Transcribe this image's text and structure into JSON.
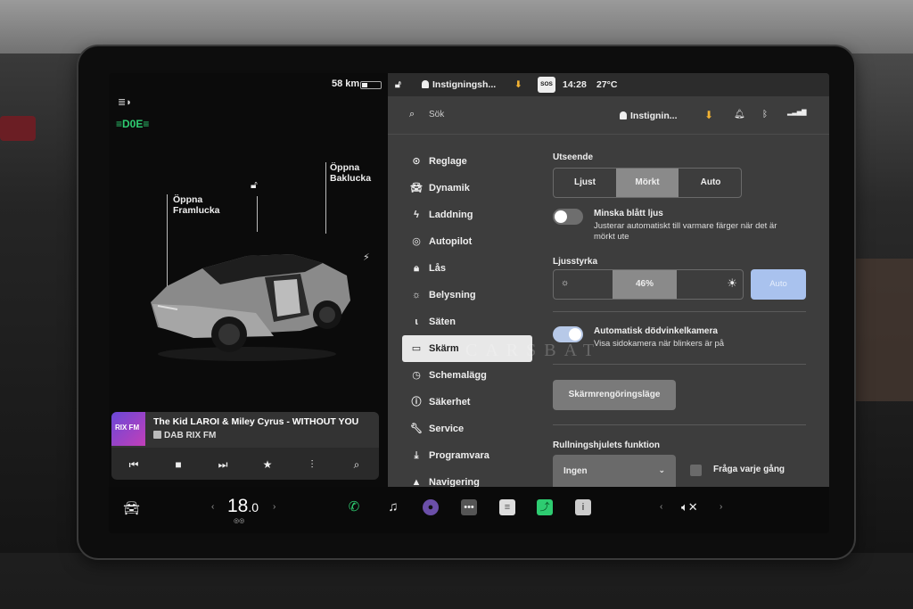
{
  "left_panel": {
    "range": "58 km",
    "front_trunk_label": "Öppna\nFramlucka",
    "rear_trunk_label": "Öppna\nBaklucka"
  },
  "media": {
    "album_label": "RIX FM",
    "song": "The Kid LAROI & Miley Cyrus - WITHOUT YOU",
    "station": "DAB RIX FM",
    "controls": [
      "previous-icon",
      "stop-icon",
      "next-icon",
      "favorite-icon",
      "equalizer-icon",
      "search-icon"
    ]
  },
  "statusbar": {
    "profile": "Instigningsh...",
    "sos": "SOS",
    "time": "14:28",
    "temperature": "27°C"
  },
  "search": {
    "placeholder": "Sök",
    "profile": "Instignin..."
  },
  "menu": {
    "items": [
      {
        "label": "Reglage",
        "icon": "toggle-icon"
      },
      {
        "label": "Dynamik",
        "icon": "car-icon"
      },
      {
        "label": "Laddning",
        "icon": "bolt-icon"
      },
      {
        "label": "Autopilot",
        "icon": "steering-wheel-icon"
      },
      {
        "label": "Lås",
        "icon": "lock-icon"
      },
      {
        "label": "Belysning",
        "icon": "light-icon"
      },
      {
        "label": "Säten",
        "icon": "seat-icon"
      },
      {
        "label": "Skärm",
        "icon": "display-icon"
      },
      {
        "label": "Schemalägg",
        "icon": "clock-icon"
      },
      {
        "label": "Säkerhet",
        "icon": "alert-icon"
      },
      {
        "label": "Service",
        "icon": "wrench-icon"
      },
      {
        "label": "Programvara",
        "icon": "download-icon"
      },
      {
        "label": "Navigering",
        "icon": "navigation-icon"
      }
    ],
    "active": "Skärm"
  },
  "display": {
    "appearance_title": "Utseende",
    "appearance_options": [
      "Ljust",
      "Mörkt",
      "Auto"
    ],
    "appearance_selected": "Mörkt",
    "blue_light_title": "Minska blått ljus",
    "blue_light_desc": "Justerar automatiskt till varmare färger när det är mörkt ute",
    "blue_light_on": false,
    "brightness_title": "Ljusstyrka",
    "brightness_value": "46%",
    "brightness_auto": "Auto",
    "blindspot_title": "Automatisk dödvinkelkamera",
    "blindspot_desc": "Visa sidokamera när blinkers är på",
    "blindspot_on": true,
    "clean_button": "Skärmrengöringsläge",
    "scroll_title": "Rullningshjulets funktion",
    "scroll_value": "Ingen",
    "ask_label": "Fråga varje gång"
  },
  "dock": {
    "temperature": "18",
    "temperature_decimal": ".0",
    "apps": [
      "phone-icon",
      "music-icon",
      "camera-icon",
      "more-icon",
      "notes-icon",
      "charts-icon",
      "info-icon"
    ]
  },
  "watermark": "CARSBAT",
  "colors": {
    "accent": "#a9c2ee",
    "green": "#2ecc71",
    "download": "#f2b233"
  }
}
